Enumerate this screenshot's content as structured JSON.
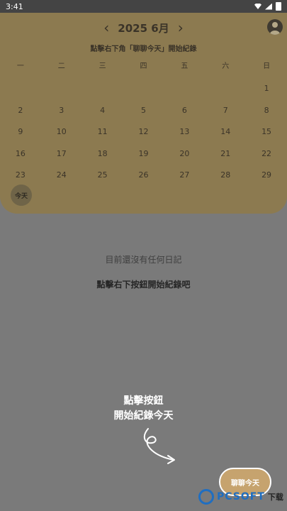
{
  "status_bar": {
    "time": "3:41"
  },
  "calendar": {
    "prev_arrow": "‹",
    "next_arrow": "›",
    "month_label": "2025 6月",
    "hint": "點擊右下角「聊聊今天」開始紀錄",
    "weekdays": [
      "一",
      "二",
      "三",
      "四",
      "五",
      "六",
      "日"
    ],
    "days": [
      "1",
      "2",
      "3",
      "4",
      "5",
      "6",
      "7",
      "8",
      "9",
      "10",
      "11",
      "12",
      "13",
      "14",
      "15",
      "16",
      "17",
      "18",
      "19",
      "20",
      "21",
      "22",
      "23",
      "24",
      "25",
      "26",
      "27",
      "28",
      "29"
    ],
    "today_label": "今天"
  },
  "main": {
    "empty_message": "目前還沒有任何日記",
    "empty_hint": "點擊右下按鈕開始紀錄吧",
    "coach_line1": "點擊按鈕",
    "coach_line2": "開始紀錄今天"
  },
  "fab": {
    "label": "聊聊今天"
  },
  "watermark": {
    "brand": "PCSOFT",
    "suffix": "下载"
  },
  "colors": {
    "panel": "#8c7a50",
    "background": "#7a7a7a",
    "accent": "#c6a36e"
  }
}
